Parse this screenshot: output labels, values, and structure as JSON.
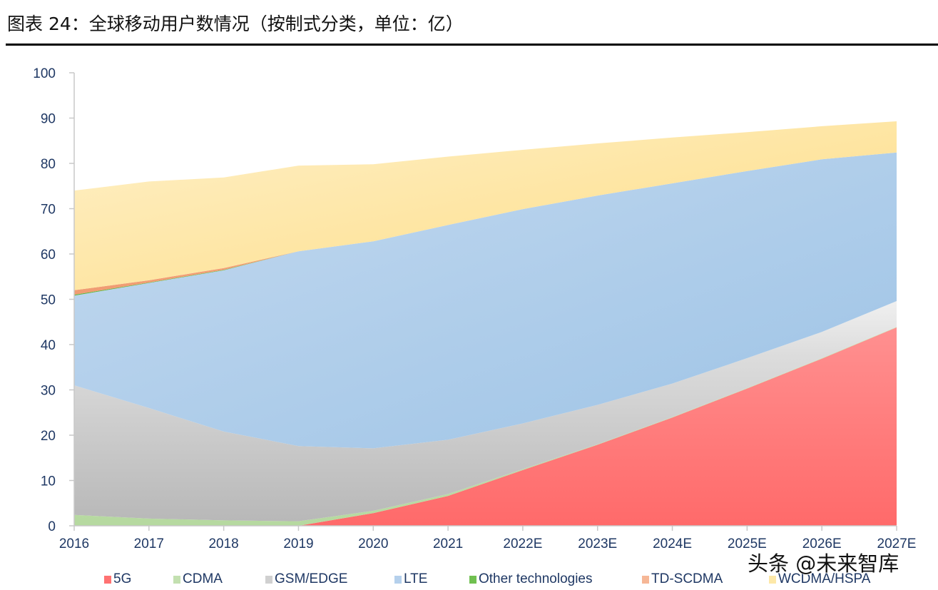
{
  "title": "图表 24：全球移动用户数情况（按制式分类，单位：亿）",
  "watermark": "头条 @未来智库",
  "chart_data": {
    "type": "area",
    "stacked": true,
    "title": "图表 24：全球移动用户数情况（按制式分类，单位：亿）",
    "xlabel": "",
    "ylabel": "",
    "unit": "亿",
    "ylim": [
      0,
      100
    ],
    "yticks": [
      0,
      10,
      20,
      30,
      40,
      50,
      60,
      70,
      80,
      90,
      100
    ],
    "grid": false,
    "legend_position": "bottom",
    "categories": [
      "2016",
      "2017",
      "2018",
      "2019",
      "2020",
      "2021",
      "2022E",
      "2023E",
      "2024E",
      "2025E",
      "2026E",
      "2027E"
    ],
    "series": [
      {
        "name": "5G",
        "color": "#ff6b6b",
        "values": [
          0,
          0,
          0,
          0,
          2.8,
          6.6,
          12.3,
          17.9,
          23.9,
          30.3,
          36.9,
          43.8
        ]
      },
      {
        "name": "CDMA",
        "color": "#b9dba3",
        "values": [
          2.4,
          1.6,
          1.2,
          1.0,
          0.5,
          0.4,
          0.2,
          0.1,
          0.1,
          0.1,
          0.1,
          0.1
        ]
      },
      {
        "name": "GSM/EDGE",
        "color": "#c4c4c4",
        "values": [
          28.6,
          24.4,
          19.6,
          16.6,
          13.8,
          12.0,
          10.1,
          8.7,
          7.4,
          6.6,
          5.8,
          5.7
        ]
      },
      {
        "name": "LTE",
        "color": "#a9c9e8",
        "values": [
          19.8,
          27.6,
          35.6,
          43.0,
          45.7,
          47.4,
          47.3,
          46.2,
          44.2,
          41.3,
          38.1,
          32.8
        ]
      },
      {
        "name": "Other technologies",
        "color": "#6cc24a",
        "values": [
          0.2,
          0.1,
          0.1,
          0.0,
          0.0,
          0.0,
          0.0,
          0.0,
          0.0,
          0.0,
          0.0,
          0.0
        ]
      },
      {
        "name": "TD-SCDMA",
        "color": "#f4a582",
        "values": [
          1.0,
          0.5,
          0.4,
          0.0,
          0.0,
          0.0,
          0.0,
          0.0,
          0.0,
          0.0,
          0.0,
          0.0
        ]
      },
      {
        "name": "WCDMA/HSPA",
        "color": "#fde39a",
        "values": [
          22.0,
          21.8,
          20.0,
          18.9,
          17.0,
          15.1,
          13.1,
          11.5,
          10.1,
          8.6,
          7.3,
          6.9
        ]
      }
    ]
  },
  "legend": [
    {
      "label": "5G",
      "color": "#ff7272"
    },
    {
      "label": "CDMA",
      "color": "#c3e0b0"
    },
    {
      "label": "GSM/EDGE",
      "color": "#d0d0d0"
    },
    {
      "label": "LTE",
      "color": "#b5d0ec"
    },
    {
      "label": "Other technologies",
      "color": "#70c050"
    },
    {
      "label": "TD-SCDMA",
      "color": "#f6b796"
    },
    {
      "label": "WCDMA/HSPA",
      "color": "#fde8a8"
    }
  ]
}
